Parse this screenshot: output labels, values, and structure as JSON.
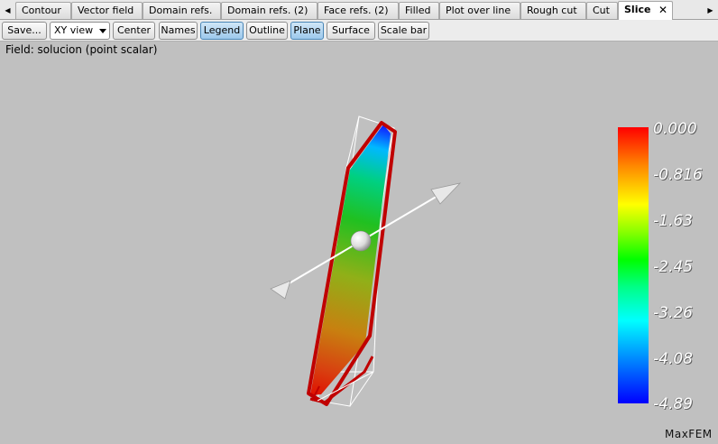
{
  "tabs": [
    {
      "label": "Contour"
    },
    {
      "label": "Vector field"
    },
    {
      "label": "Domain refs."
    },
    {
      "label": "Domain refs. (2)"
    },
    {
      "label": "Face refs. (2)"
    },
    {
      "label": "Filled"
    },
    {
      "label": "Plot over line"
    },
    {
      "label": "Rough cut"
    },
    {
      "label": "Cut"
    },
    {
      "label": "Slice",
      "active": true
    }
  ],
  "tab_close_glyph": "✕",
  "scroll_left_glyph": "◀",
  "scroll_right_glyph": "▶",
  "toolbar": {
    "save": "Save...",
    "view_select": "XY view",
    "center": "Center",
    "names": "Names",
    "legend": "Legend",
    "outline": "Outline",
    "plane": "Plane",
    "surface": "Surface",
    "scale_bar": "Scale bar"
  },
  "toggles_on": [
    "legend",
    "plane"
  ],
  "field_label": "Field: solucion (point scalar)",
  "legend": {
    "labels": [
      "0.000",
      "-0.816",
      "-1.63",
      "-2.45",
      "-3.26",
      "-4.08",
      "-4.89"
    ],
    "colors": [
      "#ff0000",
      "#ffff00",
      "#00ff00",
      "#00ffff",
      "#0000ff"
    ]
  },
  "brand": "MaxFEM",
  "colors": {
    "background": "#c0c0c0",
    "outline_red": "#c00000",
    "toggle_on": "#9dc9ec"
  }
}
